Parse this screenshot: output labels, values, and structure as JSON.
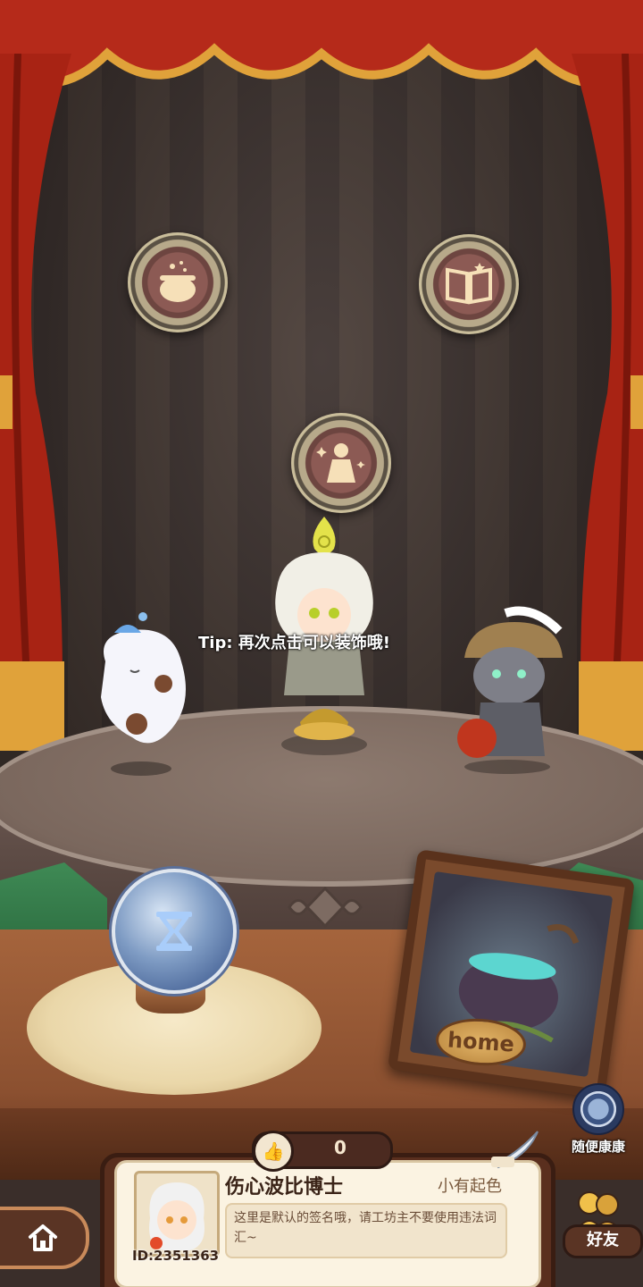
{
  "tip": "Tip: 再次点击可以装饰哦!",
  "stage": {
    "home_label": "home"
  },
  "random_visit": {
    "label": "随便康康",
    "icon": "swirl-portal-icon"
  },
  "medallions": [
    {
      "name": "cauldron-medallion",
      "icon": "cauldron-icon"
    },
    {
      "name": "book-medallion",
      "icon": "spellbook-icon"
    },
    {
      "name": "doll-medallion",
      "icon": "doll-sparkle-icon"
    }
  ],
  "profile": {
    "likes": "0",
    "name": "伤心波比博士",
    "title": "小有起色",
    "signature": "这里是默认的签名哦，请工坊主不要使用违法词汇~",
    "id": "ID:2351363"
  },
  "nav": {
    "home_icon": "house-icon",
    "friends_label": "好友"
  },
  "colors": {
    "curtain": "#b52a1a",
    "panel": "#5a2f1e",
    "card": "#fbf3e2"
  }
}
